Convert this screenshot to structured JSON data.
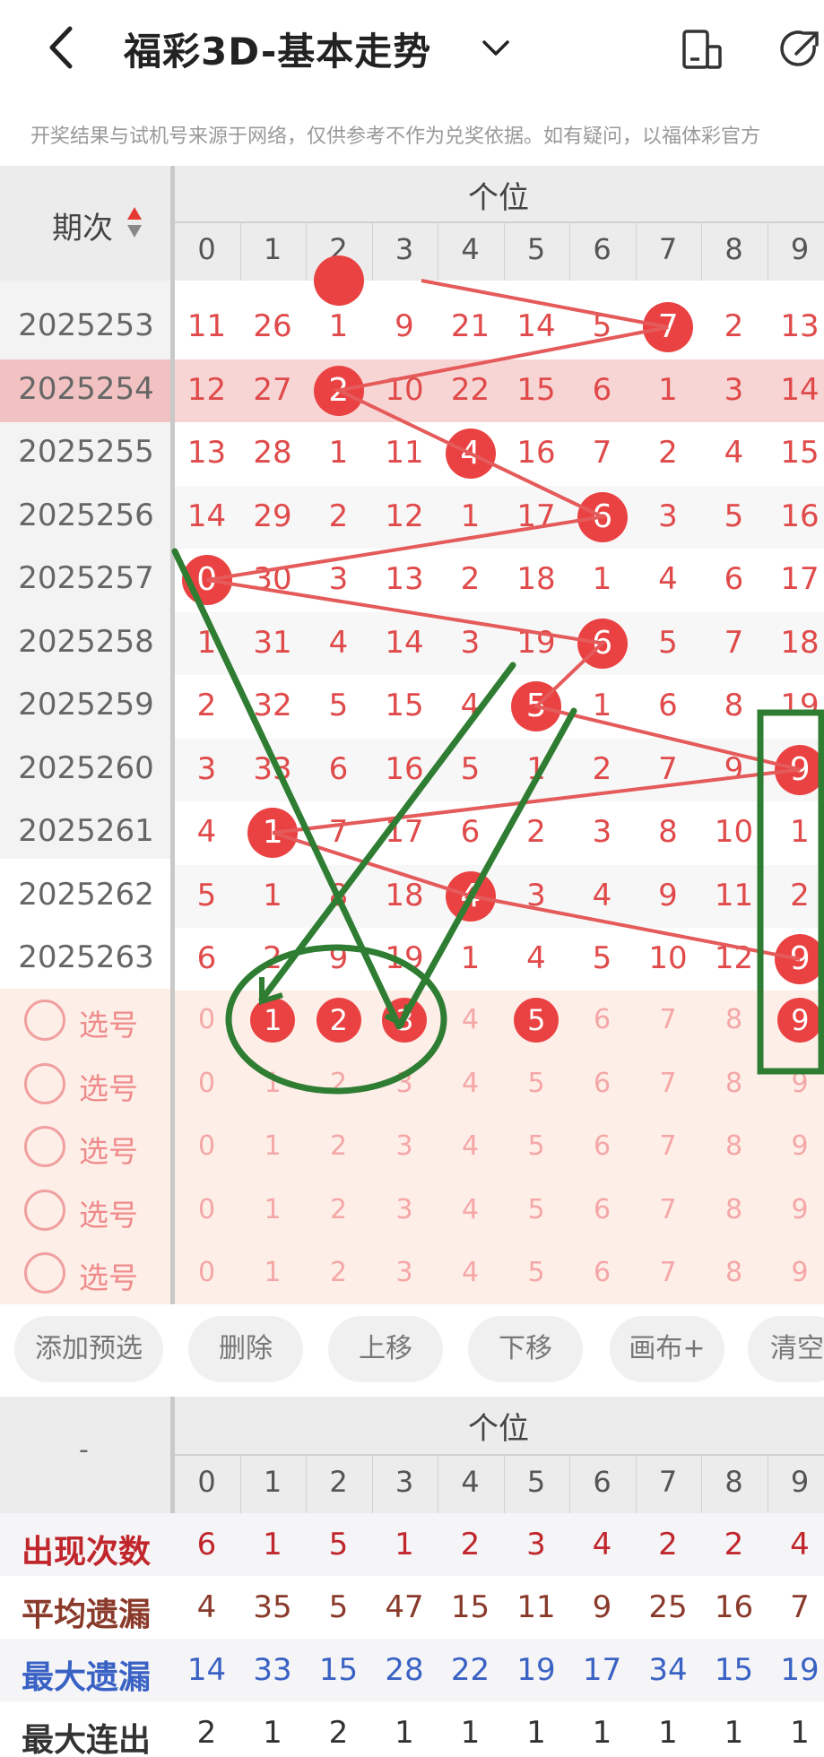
{
  "header": {
    "title": "福彩3D-基本走势",
    "notice": "开奖结果与试机号来源于网络，仅供参考不作为兑奖依据。如有疑问，以福体彩官方"
  },
  "table": {
    "period_label": "期次",
    "section_label": "个位",
    "columns": [
      "0",
      "1",
      "2",
      "3",
      "4",
      "5",
      "6",
      "7",
      "8",
      "9"
    ],
    "rows": [
      {
        "period": "2025253",
        "cells": [
          "11",
          "26",
          "1",
          "9",
          "21",
          "14",
          "5",
          "7",
          "2",
          "13"
        ],
        "hit": 7
      },
      {
        "period": "2025254",
        "cells": [
          "12",
          "27",
          "2",
          "10",
          "22",
          "15",
          "6",
          "1",
          "3",
          "14"
        ],
        "hit": 2
      },
      {
        "period": "2025255",
        "cells": [
          "13",
          "28",
          "1",
          "11",
          "4",
          "16",
          "7",
          "2",
          "4",
          "15"
        ],
        "hit": 4
      },
      {
        "period": "2025256",
        "cells": [
          "14",
          "29",
          "2",
          "12",
          "1",
          "17",
          "6",
          "3",
          "5",
          "16"
        ],
        "hit": 6
      },
      {
        "period": "2025257",
        "cells": [
          "0",
          "30",
          "3",
          "13",
          "2",
          "18",
          "1",
          "4",
          "6",
          "17"
        ],
        "hit": 0
      },
      {
        "period": "2025258",
        "cells": [
          "1",
          "31",
          "4",
          "14",
          "3",
          "19",
          "6",
          "5",
          "7",
          "18"
        ],
        "hit": 6
      },
      {
        "period": "2025259",
        "cells": [
          "2",
          "32",
          "5",
          "15",
          "4",
          "5",
          "1",
          "6",
          "8",
          "19"
        ],
        "hit": 5
      },
      {
        "period": "2025260",
        "cells": [
          "3",
          "33",
          "6",
          "16",
          "5",
          "1",
          "2",
          "7",
          "9",
          "9"
        ],
        "hit": 9
      },
      {
        "period": "2025261",
        "cells": [
          "4",
          "1",
          "7",
          "17",
          "6",
          "2",
          "3",
          "8",
          "10",
          "1"
        ],
        "hit": 1
      },
      {
        "period": "2025262",
        "cells": [
          "5",
          "1",
          "8",
          "18",
          "4",
          "3",
          "4",
          "9",
          "11",
          "2"
        ],
        "hit": 4
      },
      {
        "period": "2025263",
        "cells": [
          "6",
          "2",
          "9",
          "19",
          "1",
          "4",
          "5",
          "10",
          "12",
          "9"
        ],
        "hit": 9
      }
    ],
    "pick_label": "选号",
    "pick_rows": [
      {
        "selected": [
          1,
          2,
          3,
          5,
          9
        ]
      },
      {
        "selected": []
      },
      {
        "selected": []
      },
      {
        "selected": []
      },
      {
        "selected": []
      }
    ]
  },
  "buttons": [
    "添加预选",
    "删除",
    "上移",
    "下移",
    "画布+",
    "清空"
  ],
  "stats": {
    "dash": "-",
    "section_label": "个位",
    "columns": [
      "0",
      "1",
      "2",
      "3",
      "4",
      "5",
      "6",
      "7",
      "8",
      "9"
    ],
    "rows": [
      {
        "label": "出现次数",
        "color": "#c0262b",
        "values": [
          "6",
          "1",
          "5",
          "1",
          "2",
          "3",
          "4",
          "2",
          "2",
          "4"
        ]
      },
      {
        "label": "平均遗漏",
        "color": "#8a3a2a",
        "values": [
          "4",
          "35",
          "5",
          "47",
          "15",
          "11",
          "9",
          "25",
          "16",
          "7"
        ]
      },
      {
        "label": "最大遗漏",
        "color": "#3a62c4",
        "values": [
          "14",
          "33",
          "15",
          "28",
          "22",
          "19",
          "17",
          "34",
          "15",
          "19"
        ]
      },
      {
        "label": "最大连出",
        "color": "#333333",
        "values": [
          "2",
          "1",
          "2",
          "1",
          "1",
          "1",
          "1",
          "1",
          "1",
          "1"
        ]
      }
    ]
  },
  "colors": {
    "ball": "#ea4242",
    "accent_green": "#2e7d32",
    "row_highlight": "#f8d5d5"
  }
}
